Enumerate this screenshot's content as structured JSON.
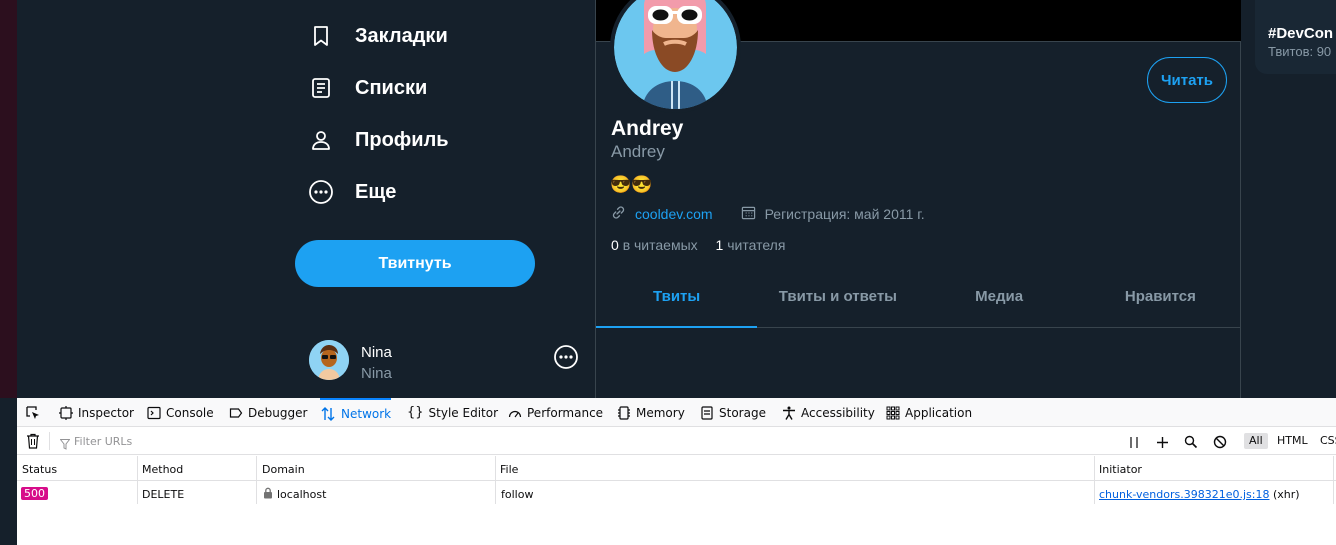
{
  "nav": {
    "items": [
      {
        "label": "Закладки",
        "icon": "bookmark-icon"
      },
      {
        "label": "Списки",
        "icon": "list-icon"
      },
      {
        "label": "Профиль",
        "icon": "profile-icon"
      },
      {
        "label": "Еще",
        "icon": "more-circle-icon"
      }
    ],
    "tweet_button": "Твитнуть"
  },
  "current_user": {
    "name": "Nina",
    "handle": "Nina"
  },
  "profile": {
    "name": "Andrey",
    "handle": "Andrey",
    "bio": "😎😎",
    "follow_button": "Читать",
    "website": "cooldev.com",
    "joined": "Регистрация: май 2011 г.",
    "following_count": "0",
    "following_label": "в читаемых",
    "followers_count": "1",
    "followers_label": "читателя",
    "tabs": [
      "Твиты",
      "Твиты и ответы",
      "Медиа",
      "Нравится"
    ],
    "active_tab": 0
  },
  "trend": {
    "tag": "#DevCon",
    "count": "Твитов: 90"
  },
  "devtools": {
    "tabs": [
      "Inspector",
      "Console",
      "Debugger",
      "Network",
      "Style Editor",
      "Performance",
      "Memory",
      "Storage",
      "Accessibility",
      "Application"
    ],
    "active_tab": "Network",
    "filter_placeholder": "Filter URLs",
    "type_filters": [
      "All",
      "HTML",
      "CSS"
    ],
    "columns": [
      "Status",
      "Method",
      "Domain",
      "File",
      "Initiator"
    ],
    "rows": [
      {
        "status": "500",
        "method": "DELETE",
        "domain": "localhost",
        "file": "follow",
        "initiator_link": "chunk-vendors.398321e0.js:18",
        "initiator_type": "(xhr)"
      }
    ]
  },
  "colors": {
    "accent": "#1da1f2",
    "background": "#15202b",
    "error_badge": "#d70c8a"
  }
}
